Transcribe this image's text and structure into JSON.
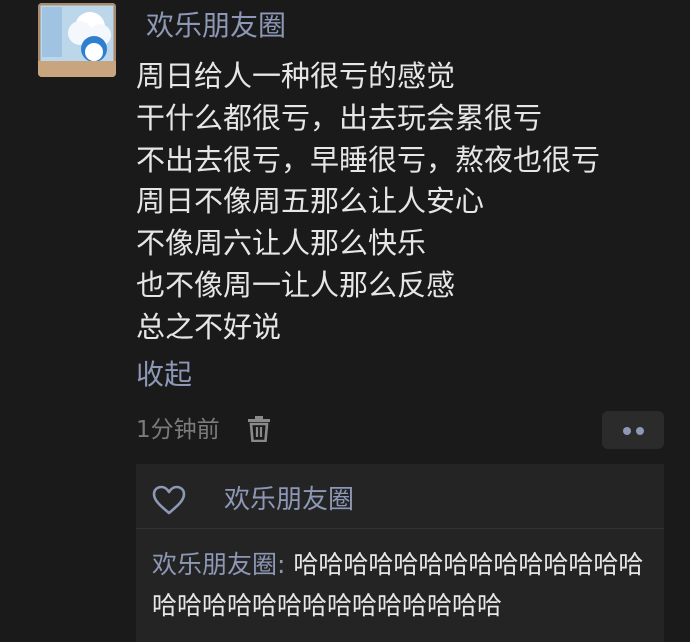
{
  "post": {
    "username": "欢乐朋友圈",
    "lines": [
      "周日给人一种很亏的感觉",
      "干什么都很亏，出去玩会累很亏",
      "不出去很亏，早睡很亏，熬夜也很亏",
      "周日不像周五那么让人安心",
      "不像周六让人那么快乐",
      "也不像周一让人那么反感",
      "总之不好说"
    ],
    "collapse_label": "收起",
    "timestamp": "1分钟前"
  },
  "icons": {
    "avatar": "avatar-image",
    "delete": "trash-icon",
    "more": "more-dots-icon",
    "like": "heart-icon"
  },
  "colors": {
    "background": "#1a1a1a",
    "link": "#8c98b6",
    "text": "#e6e6e6",
    "muted": "#7b7b7b",
    "panel": "#242424"
  },
  "interactions": {
    "likers": "欢乐朋友圈",
    "comments": [
      {
        "author": "欢乐朋友圈",
        "separator": ": ",
        "text": "哈哈哈哈哈哈哈哈哈哈哈哈哈哈哈哈哈哈哈哈哈哈哈哈哈哈哈哈"
      }
    ]
  }
}
